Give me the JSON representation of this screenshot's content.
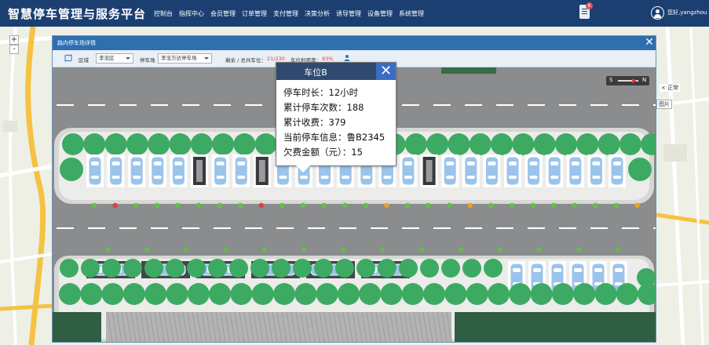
{
  "header": {
    "app_title": "智慧停车管理与服务平台",
    "nav": [
      "控制台",
      "指挥中心",
      "会员管理",
      "订单管理",
      "支付管理",
      "决策分析",
      "诱导管理",
      "设备管理",
      "系统管理"
    ],
    "notification_count": "6",
    "user_greeting": "您好,yangzhou"
  },
  "map": {
    "zoom_in": "+",
    "zoom_out": "-",
    "side_label_1": "× 正常",
    "side_label_2": "图片"
  },
  "modal": {
    "title": "路内停车场详情",
    "close": "✕",
    "filters": {
      "area_label": "区域",
      "area_value": "李沧区",
      "lot_label": "停车场",
      "lot_value": "李沧万达停车场",
      "remaining_label": "剩余 / 总共车位：",
      "remaining_value": "21/230",
      "usage_label": "车位利用率：",
      "usage_value": "93%"
    }
  },
  "compass": {
    "south": "S",
    "north": "N"
  },
  "popup": {
    "title": "车位B",
    "close": "✕",
    "lines": [
      "停车时长：12小时",
      "累计停车次数：188",
      "累计收费：379",
      "当前停车信息：鲁B2345",
      "欠费金额（元）：15"
    ]
  },
  "colors": {
    "header_bg": "#1c3f72",
    "modal_title_bg": "#2e6fb0",
    "popup_header_bg": "#2f4a6e",
    "popup_close_bg": "#3a6cc4",
    "tree": "#3daa63",
    "occupied_spot": "#9bc4ec",
    "empty_spot": "#35393e",
    "sensor_ok": "#60c04a",
    "sensor_alarm": "#e0413a",
    "sensor_warn": "#f0a020"
  },
  "lot_state": {
    "top_row": [
      "occupied",
      "occupied",
      "occupied",
      "occupied",
      "occupied",
      "empty",
      "occupied",
      "occupied",
      "empty",
      "occupied",
      "occupied",
      "occupied",
      "occupied",
      "occupied",
      "occupied",
      "occupied",
      "empty",
      "occupied",
      "occupied",
      "occupied",
      "occupied",
      "occupied",
      "occupied",
      "occupied",
      "occupied",
      "occupied"
    ],
    "sensors": [
      "ok",
      "alarm",
      "ok",
      "ok",
      "ok",
      "ok",
      "ok",
      "ok",
      "alarm",
      "ok",
      "ok",
      "ok",
      "ok",
      "ok",
      "warn",
      "ok",
      "ok",
      "ok",
      "warn",
      "ok",
      "ok",
      "ok",
      "ok",
      "ok",
      "ok",
      "ok",
      "warn"
    ],
    "bottom_horizontal": [
      "occupied",
      "occupied",
      "occupied",
      "occupied",
      "occupied",
      "occupied"
    ],
    "bottom_vertical": [
      "occupied",
      "occupied",
      "occupied",
      "occupied",
      "occupied",
      "occupied"
    ]
  }
}
